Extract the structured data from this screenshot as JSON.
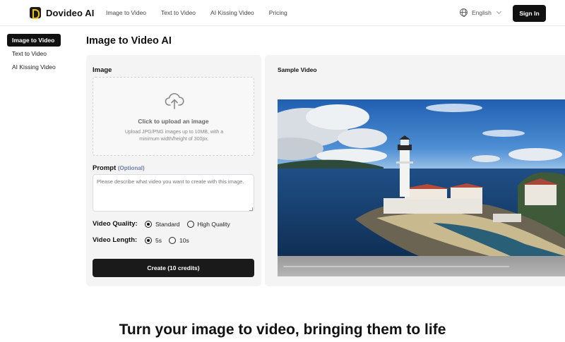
{
  "brand": {
    "name": "Dovideo AI"
  },
  "nav": {
    "links": [
      "Image to Video",
      "Text to Video",
      "AI Kissing Video",
      "Pricing"
    ],
    "language": "English",
    "signin_label": "Sign In"
  },
  "sidebar": {
    "items": [
      {
        "label": "Image to Video",
        "active": true
      },
      {
        "label": "Text to Video",
        "active": false
      },
      {
        "label": "AI Kissing Video",
        "active": false
      }
    ]
  },
  "page": {
    "title": "Image to Video AI"
  },
  "form": {
    "image_label": "Image",
    "upload_title": "Click to upload an image",
    "upload_hint": "Upload JPG/PNG images up to 10MB, with a minimum width/height of 300px.",
    "prompt_label": "Prompt",
    "prompt_optional": "(Optional)",
    "prompt_placeholder": "Please describe what video you want to create with this image.",
    "quality_label": "Video Quality:",
    "quality_options": [
      "Standard",
      "High Quality"
    ],
    "quality_selected": "Standard",
    "length_label": "Video Length:",
    "length_options": [
      "5s",
      "10s"
    ],
    "length_selected": "5s",
    "create_label": "Create (10 credits)"
  },
  "sample": {
    "label": "Sample Video"
  },
  "hero": {
    "title": "Turn your image to video, bringing them to life"
  },
  "colors": {
    "primary": "#111111",
    "panel": "#f4f4f5",
    "optional_text": "#6b7fa8",
    "logo_accent": "#f1c40f"
  }
}
